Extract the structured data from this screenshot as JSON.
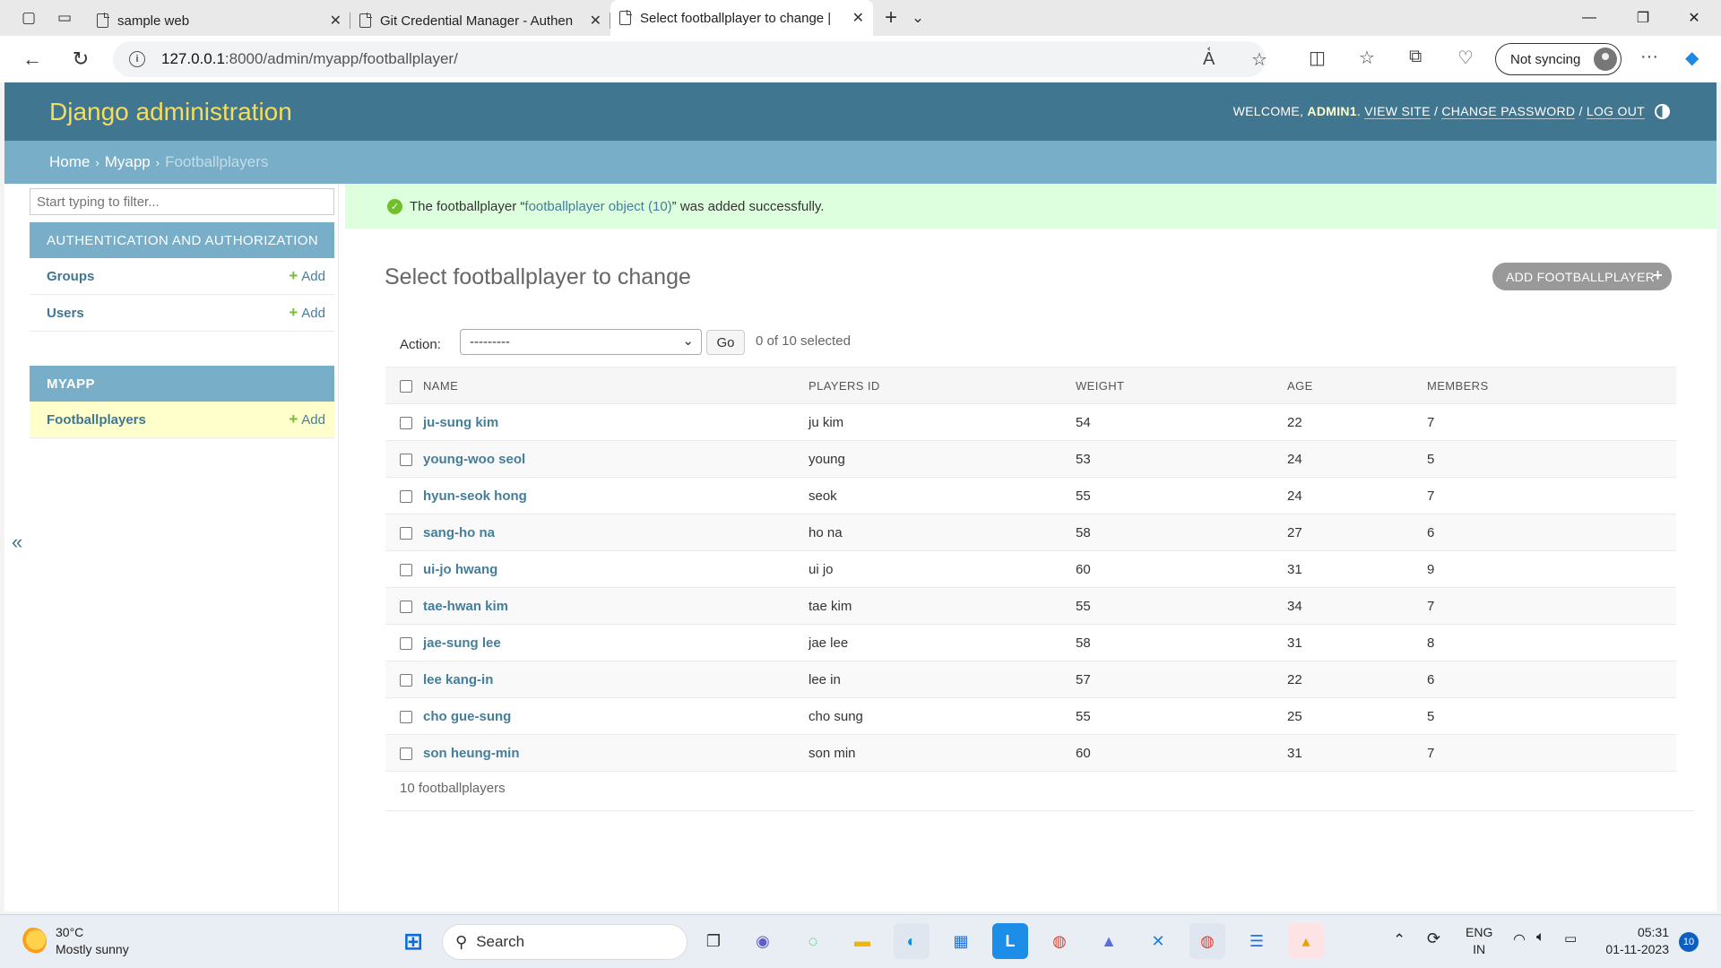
{
  "browser": {
    "tabs": [
      {
        "title": "sample web",
        "close": "✕"
      },
      {
        "title": "Git Credential Manager - Authen",
        "close": "✕"
      },
      {
        "title": "Select footballplayer to change |",
        "close": "✕"
      }
    ],
    "new_tab": "+",
    "tab_list": "⌄",
    "url_host": "127.0.0.1",
    "url_path": ":8000/admin/myapp/footballplayer/",
    "profile_label": "Not syncing",
    "window_controls": {
      "minimize": "—",
      "restore": "❐",
      "close": "✕"
    }
  },
  "django": {
    "branding": "Django administration",
    "user_tools": {
      "welcome": "WELCOME, ",
      "username": "ADMIN1",
      "view_site": "VIEW SITE",
      "change_password": "CHANGE PASSWORD",
      "log_out": "LOG OUT",
      "separator": " / "
    },
    "breadcrumbs": {
      "home": "Home",
      "app": "Myapp",
      "current": "Footballplayers",
      "sep": "›"
    },
    "sidebar": {
      "filter_placeholder": "Start typing to filter...",
      "collapse": "«",
      "apps": [
        {
          "caption": "AUTHENTICATION AND AUTHORIZATION",
          "models": [
            {
              "name": "Groups",
              "add": "Add"
            },
            {
              "name": "Users",
              "add": "Add"
            }
          ]
        },
        {
          "caption": "MYAPP",
          "models": [
            {
              "name": "Footballplayers",
              "add": "Add"
            }
          ]
        }
      ]
    },
    "message": {
      "prefix": "The footballplayer “",
      "link": "footballplayer object (10)",
      "suffix": "” was added successfully."
    },
    "title": "Select footballplayer to change",
    "add_button": "ADD FOOTBALLPLAYER",
    "actions": {
      "label": "Action:",
      "selected_option": "---------",
      "go": "Go",
      "counter": "0 of 10 selected"
    },
    "table": {
      "headers": [
        "NAME",
        "PLAYERS ID",
        "WEIGHT",
        "AGE",
        "MEMBERS"
      ],
      "rows": [
        {
          "name": "ju-sung kim",
          "players_id": "ju kim",
          "weight": "54",
          "age": "22",
          "members": "7"
        },
        {
          "name": "young-woo seol",
          "players_id": "young",
          "weight": "53",
          "age": "24",
          "members": "5"
        },
        {
          "name": "hyun-seok hong",
          "players_id": "seok",
          "weight": "55",
          "age": "24",
          "members": "7"
        },
        {
          "name": "sang-ho na",
          "players_id": "ho na",
          "weight": "58",
          "age": "27",
          "members": "6"
        },
        {
          "name": "ui-jo hwang",
          "players_id": "ui jo",
          "weight": "60",
          "age": "31",
          "members": "9"
        },
        {
          "name": "tae-hwan kim",
          "players_id": "tae kim",
          "weight": "55",
          "age": "34",
          "members": "7"
        },
        {
          "name": "jae-sung lee",
          "players_id": "jae lee",
          "weight": "58",
          "age": "31",
          "members": "8"
        },
        {
          "name": "lee kang-in",
          "players_id": "lee in",
          "weight": "57",
          "age": "22",
          "members": "6"
        },
        {
          "name": "cho gue-sung",
          "players_id": "cho sung",
          "weight": "55",
          "age": "25",
          "members": "5"
        },
        {
          "name": "son heung-min",
          "players_id": "son min",
          "weight": "60",
          "age": "31",
          "members": "7"
        }
      ]
    },
    "paginator": "10 footballplayers"
  },
  "taskbar": {
    "weather": {
      "temp": "30°C",
      "desc": "Mostly sunny"
    },
    "search_placeholder": "Search",
    "language": {
      "top": "ENG",
      "bottom": "IN"
    },
    "clock": {
      "time": "05:31",
      "date": "01-11-2023"
    },
    "notifications": "10"
  },
  "colors": {
    "header": "#417690",
    "breadcrumbs": "#79aec8",
    "branding_text": "#f5dd5d",
    "link": "#447e9b",
    "success_bg": "#ddffdd",
    "selected_row": "#ffffcc"
  }
}
